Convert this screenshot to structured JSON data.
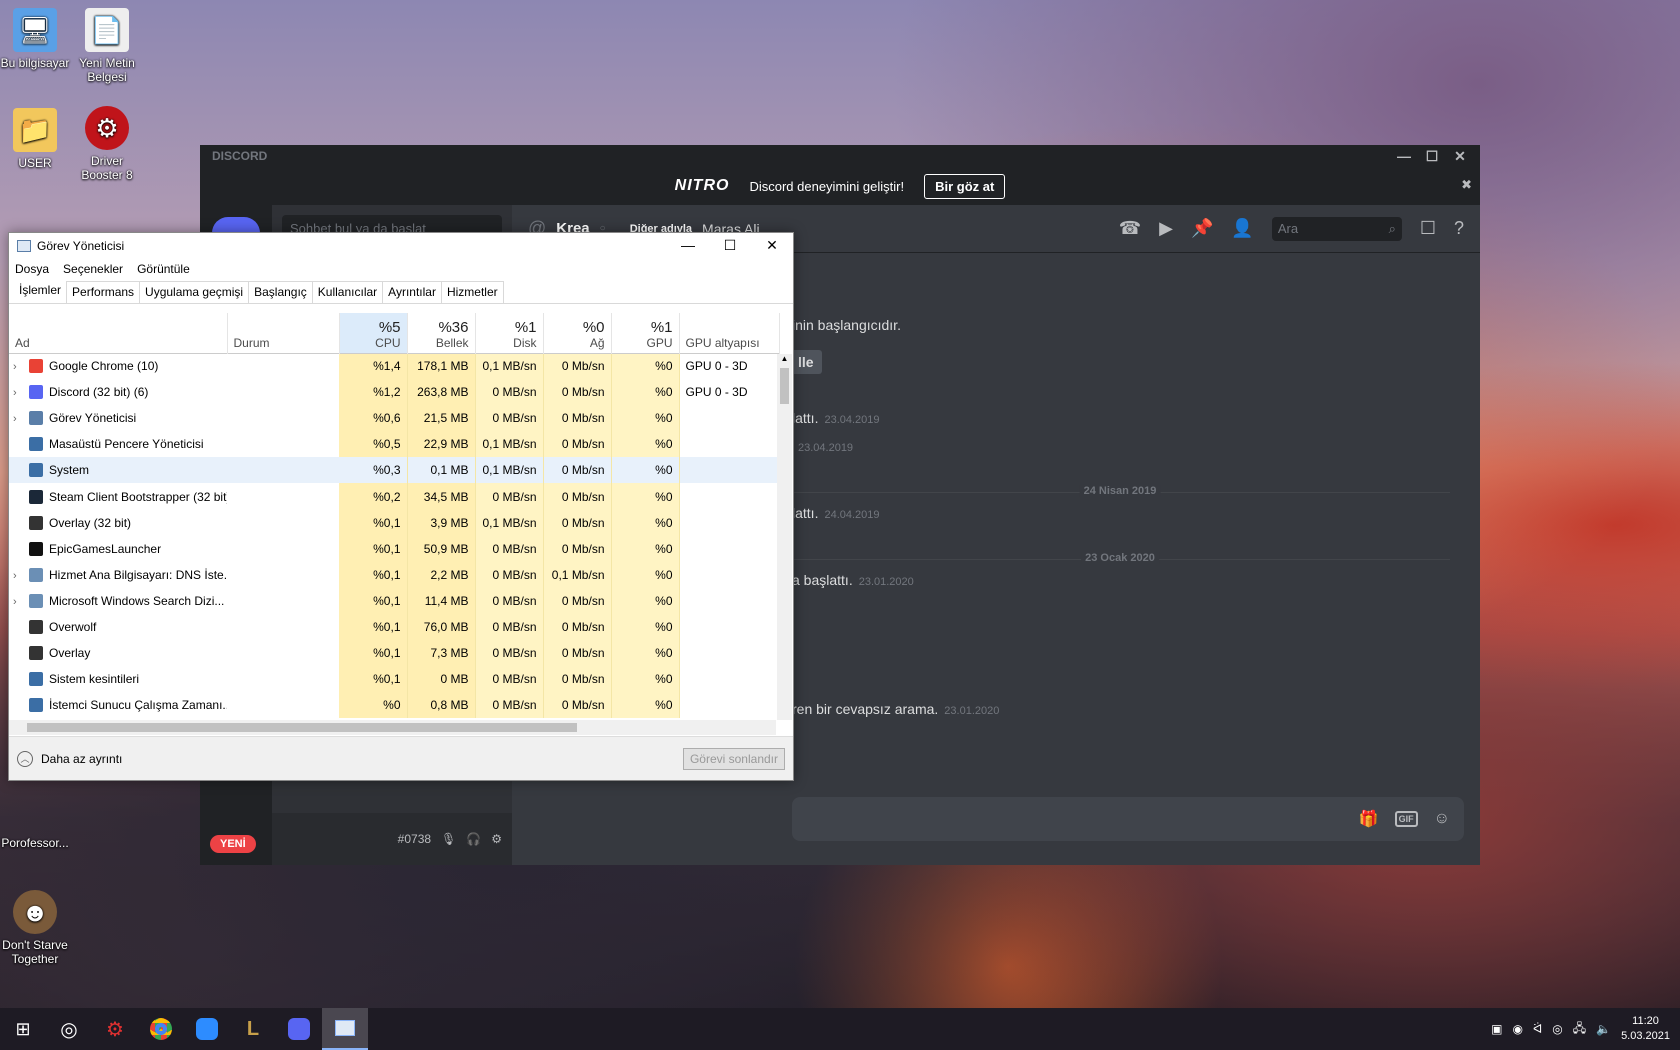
{
  "desktop": {
    "icons": [
      {
        "label": "Bu bilgisayar",
        "glyph": "🖥"
      },
      {
        "label": "Yeni Metin Belgesi",
        "glyph": "📄"
      },
      {
        "label": "USER",
        "glyph": "📁"
      },
      {
        "label": "Driver Booster 8",
        "glyph": "⚙"
      },
      {
        "label": "Porofessor...",
        "glyph": ""
      },
      {
        "label": "Don't Starve Together",
        "glyph": "☻"
      }
    ]
  },
  "discord": {
    "app_title": "DISCORD",
    "nitro": {
      "logo": "NITRO",
      "text": "Discord deneyimini geliştir!",
      "button": "Bir göz at"
    },
    "search_placeholder": "Sohbet bul ya da başlat",
    "header": {
      "name": "Krea",
      "alt_label": "Diğer adıyla",
      "alt_name": "Maraş Ali",
      "search_placeholder": "Ara"
    },
    "messages": [
      {
        "text": "inin başlangıcıdır.",
        "time": ""
      },
      {
        "text": "lle",
        "time": ""
      },
      {
        "text": "lattı.",
        "time": "23.04.2019"
      },
      {
        "text": "",
        "time": "23.04.2019"
      },
      {
        "text": "lattı.",
        "time": "24.04.2019"
      },
      {
        "text": "a başlattı.",
        "time": "23.01.2020"
      },
      {
        "text": "ren bir cevapsız arama.",
        "time": "23.01.2020"
      }
    ],
    "dividers": [
      "24 Nisan 2019",
      "23 Ocak 2020"
    ],
    "user": {
      "discriminator": "#0738",
      "new_badge": "YENİ"
    },
    "composer": {
      "gif": "GIF"
    }
  },
  "taskmgr": {
    "title": "Görev Yöneticisi",
    "menu": [
      "Dosya",
      "Seçenekler",
      "Görüntüle"
    ],
    "tabs": [
      "İşlemler",
      "Performans",
      "Uygulama geçmişi",
      "Başlangıç",
      "Kullanıcılar",
      "Ayrıntılar",
      "Hizmetler"
    ],
    "columns": {
      "name": "Ad",
      "status": "Durum",
      "cpu": {
        "pct": "%5",
        "label": "CPU"
      },
      "mem": {
        "pct": "%36",
        "label": "Bellek"
      },
      "disk": {
        "pct": "%1",
        "label": "Disk"
      },
      "net": {
        "pct": "%0",
        "label": "Ağ"
      },
      "gpu": {
        "pct": "%1",
        "label": "GPU"
      },
      "gpu_engine": "GPU altyapısı"
    },
    "rows": [
      {
        "name": "Google Chrome (10)",
        "cpu": "%1,4",
        "mem": "178,1 MB",
        "disk": "0,1 MB/sn",
        "net": "0 Mb/sn",
        "gpu": "%0",
        "engine": "GPU 0 - 3D",
        "expand": true,
        "color": "#e94235"
      },
      {
        "name": "Discord (32 bit) (6)",
        "cpu": "%1,2",
        "mem": "263,8 MB",
        "disk": "0 MB/sn",
        "net": "0 Mb/sn",
        "gpu": "%0",
        "engine": "GPU 0 - 3D",
        "expand": true,
        "color": "#5865f2"
      },
      {
        "name": "Görev Yöneticisi",
        "cpu": "%0,6",
        "mem": "21,5 MB",
        "disk": "0 MB/sn",
        "net": "0 Mb/sn",
        "gpu": "%0",
        "engine": "",
        "expand": true,
        "color": "#5a7ea8"
      },
      {
        "name": "Masaüstü Pencere Yöneticisi",
        "cpu": "%0,5",
        "mem": "22,9 MB",
        "disk": "0,1 MB/sn",
        "net": "0 Mb/sn",
        "gpu": "%0",
        "engine": "",
        "expand": false,
        "color": "#3b6ea5"
      },
      {
        "name": "System",
        "cpu": "%0,3",
        "mem": "0,1 MB",
        "disk": "0,1 MB/sn",
        "net": "0 Mb/sn",
        "gpu": "%0",
        "engine": "",
        "expand": false,
        "color": "#3b6ea5"
      },
      {
        "name": "Steam Client Bootstrapper (32 bit)",
        "cpu": "%0,2",
        "mem": "34,5 MB",
        "disk": "0 MB/sn",
        "net": "0 Mb/sn",
        "gpu": "%0",
        "engine": "",
        "expand": false,
        "color": "#1b2838"
      },
      {
        "name": "Overlay (32 bit)",
        "cpu": "%0,1",
        "mem": "3,9 MB",
        "disk": "0,1 MB/sn",
        "net": "0 Mb/sn",
        "gpu": "%0",
        "engine": "",
        "expand": false,
        "color": "#333"
      },
      {
        "name": "EpicGamesLauncher",
        "cpu": "%0,1",
        "mem": "50,9 MB",
        "disk": "0 MB/sn",
        "net": "0 Mb/sn",
        "gpu": "%0",
        "engine": "",
        "expand": false,
        "color": "#111"
      },
      {
        "name": "Hizmet Ana Bilgisayarı: DNS İste...",
        "cpu": "%0,1",
        "mem": "2,2 MB",
        "disk": "0 MB/sn",
        "net": "0,1 Mb/sn",
        "gpu": "%0",
        "engine": "",
        "expand": true,
        "color": "#6b8fb5"
      },
      {
        "name": "Microsoft Windows Search Dizi...",
        "cpu": "%0,1",
        "mem": "11,4 MB",
        "disk": "0 MB/sn",
        "net": "0 Mb/sn",
        "gpu": "%0",
        "engine": "",
        "expand": true,
        "color": "#6b8fb5"
      },
      {
        "name": "Overwolf",
        "cpu": "%0,1",
        "mem": "76,0 MB",
        "disk": "0 MB/sn",
        "net": "0 Mb/sn",
        "gpu": "%0",
        "engine": "",
        "expand": false,
        "color": "#333"
      },
      {
        "name": "Overlay",
        "cpu": "%0,1",
        "mem": "7,3 MB",
        "disk": "0 MB/sn",
        "net": "0 Mb/sn",
        "gpu": "%0",
        "engine": "",
        "expand": false,
        "color": "#333"
      },
      {
        "name": "Sistem kesintileri",
        "cpu": "%0,1",
        "mem": "0 MB",
        "disk": "0 MB/sn",
        "net": "0 Mb/sn",
        "gpu": "%0",
        "engine": "",
        "expand": false,
        "color": "#3b6ea5"
      },
      {
        "name": "İstemci Sunucu Çalışma Zamanı...",
        "cpu": "%0",
        "mem": "0,8 MB",
        "disk": "0 MB/sn",
        "net": "0 Mb/sn",
        "gpu": "%0",
        "engine": "",
        "expand": false,
        "color": "#3b6ea5"
      }
    ],
    "footer": {
      "less": "Daha az ayrıntı",
      "end": "Görevi sonlandır"
    }
  },
  "taskbar": {
    "time": "11:20",
    "date": "5.03.2021",
    "apps": [
      "start",
      "steam",
      "driver-booster",
      "chrome",
      "zoom",
      "league",
      "discord",
      "task-manager"
    ]
  }
}
